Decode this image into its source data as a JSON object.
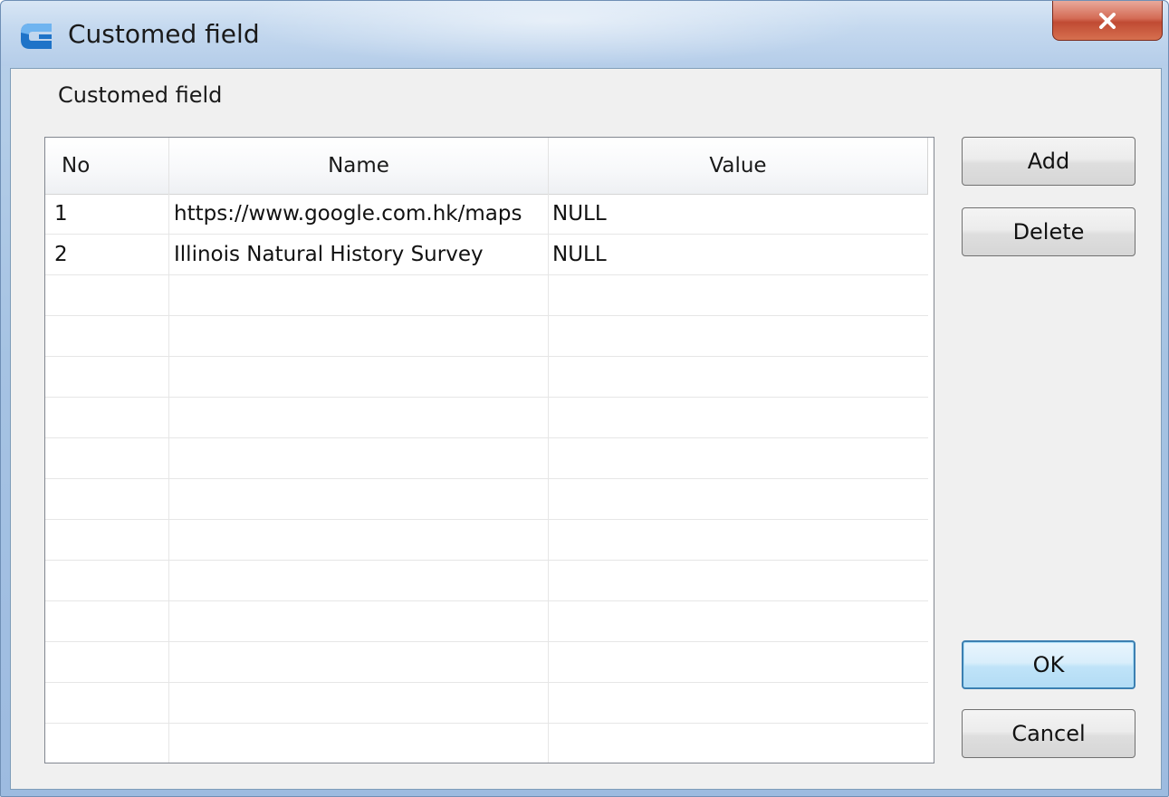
{
  "window": {
    "title": "Customed field",
    "close_label": "X"
  },
  "group": {
    "label": "Customed field"
  },
  "table": {
    "headers": {
      "no": "No",
      "name": "Name",
      "value": "Value"
    },
    "rows": [
      {
        "no": "1",
        "name": "https://www.google.com.hk/maps",
        "value": "NULL"
      },
      {
        "no": "2",
        "name": "Illinois Natural History Survey",
        "value": "NULL"
      },
      {
        "no": "",
        "name": "",
        "value": ""
      },
      {
        "no": "",
        "name": "",
        "value": ""
      },
      {
        "no": "",
        "name": "",
        "value": ""
      },
      {
        "no": "",
        "name": "",
        "value": ""
      },
      {
        "no": "",
        "name": "",
        "value": ""
      },
      {
        "no": "",
        "name": "",
        "value": ""
      },
      {
        "no": "",
        "name": "",
        "value": ""
      },
      {
        "no": "",
        "name": "",
        "value": ""
      },
      {
        "no": "",
        "name": "",
        "value": ""
      },
      {
        "no": "",
        "name": "",
        "value": ""
      },
      {
        "no": "",
        "name": "",
        "value": ""
      },
      {
        "no": "",
        "name": "",
        "value": ""
      }
    ]
  },
  "buttons": {
    "add": "Add",
    "delete": "Delete",
    "ok": "OK",
    "cancel": "Cancel"
  },
  "colors": {
    "icon_blue": "#1e73c8",
    "icon_light": "#6fb4f0",
    "close_red": "#c04a33",
    "default_button_border": "#3c7fb1"
  },
  "icons": {
    "app": "app-logo-icon",
    "close": "close-icon"
  }
}
